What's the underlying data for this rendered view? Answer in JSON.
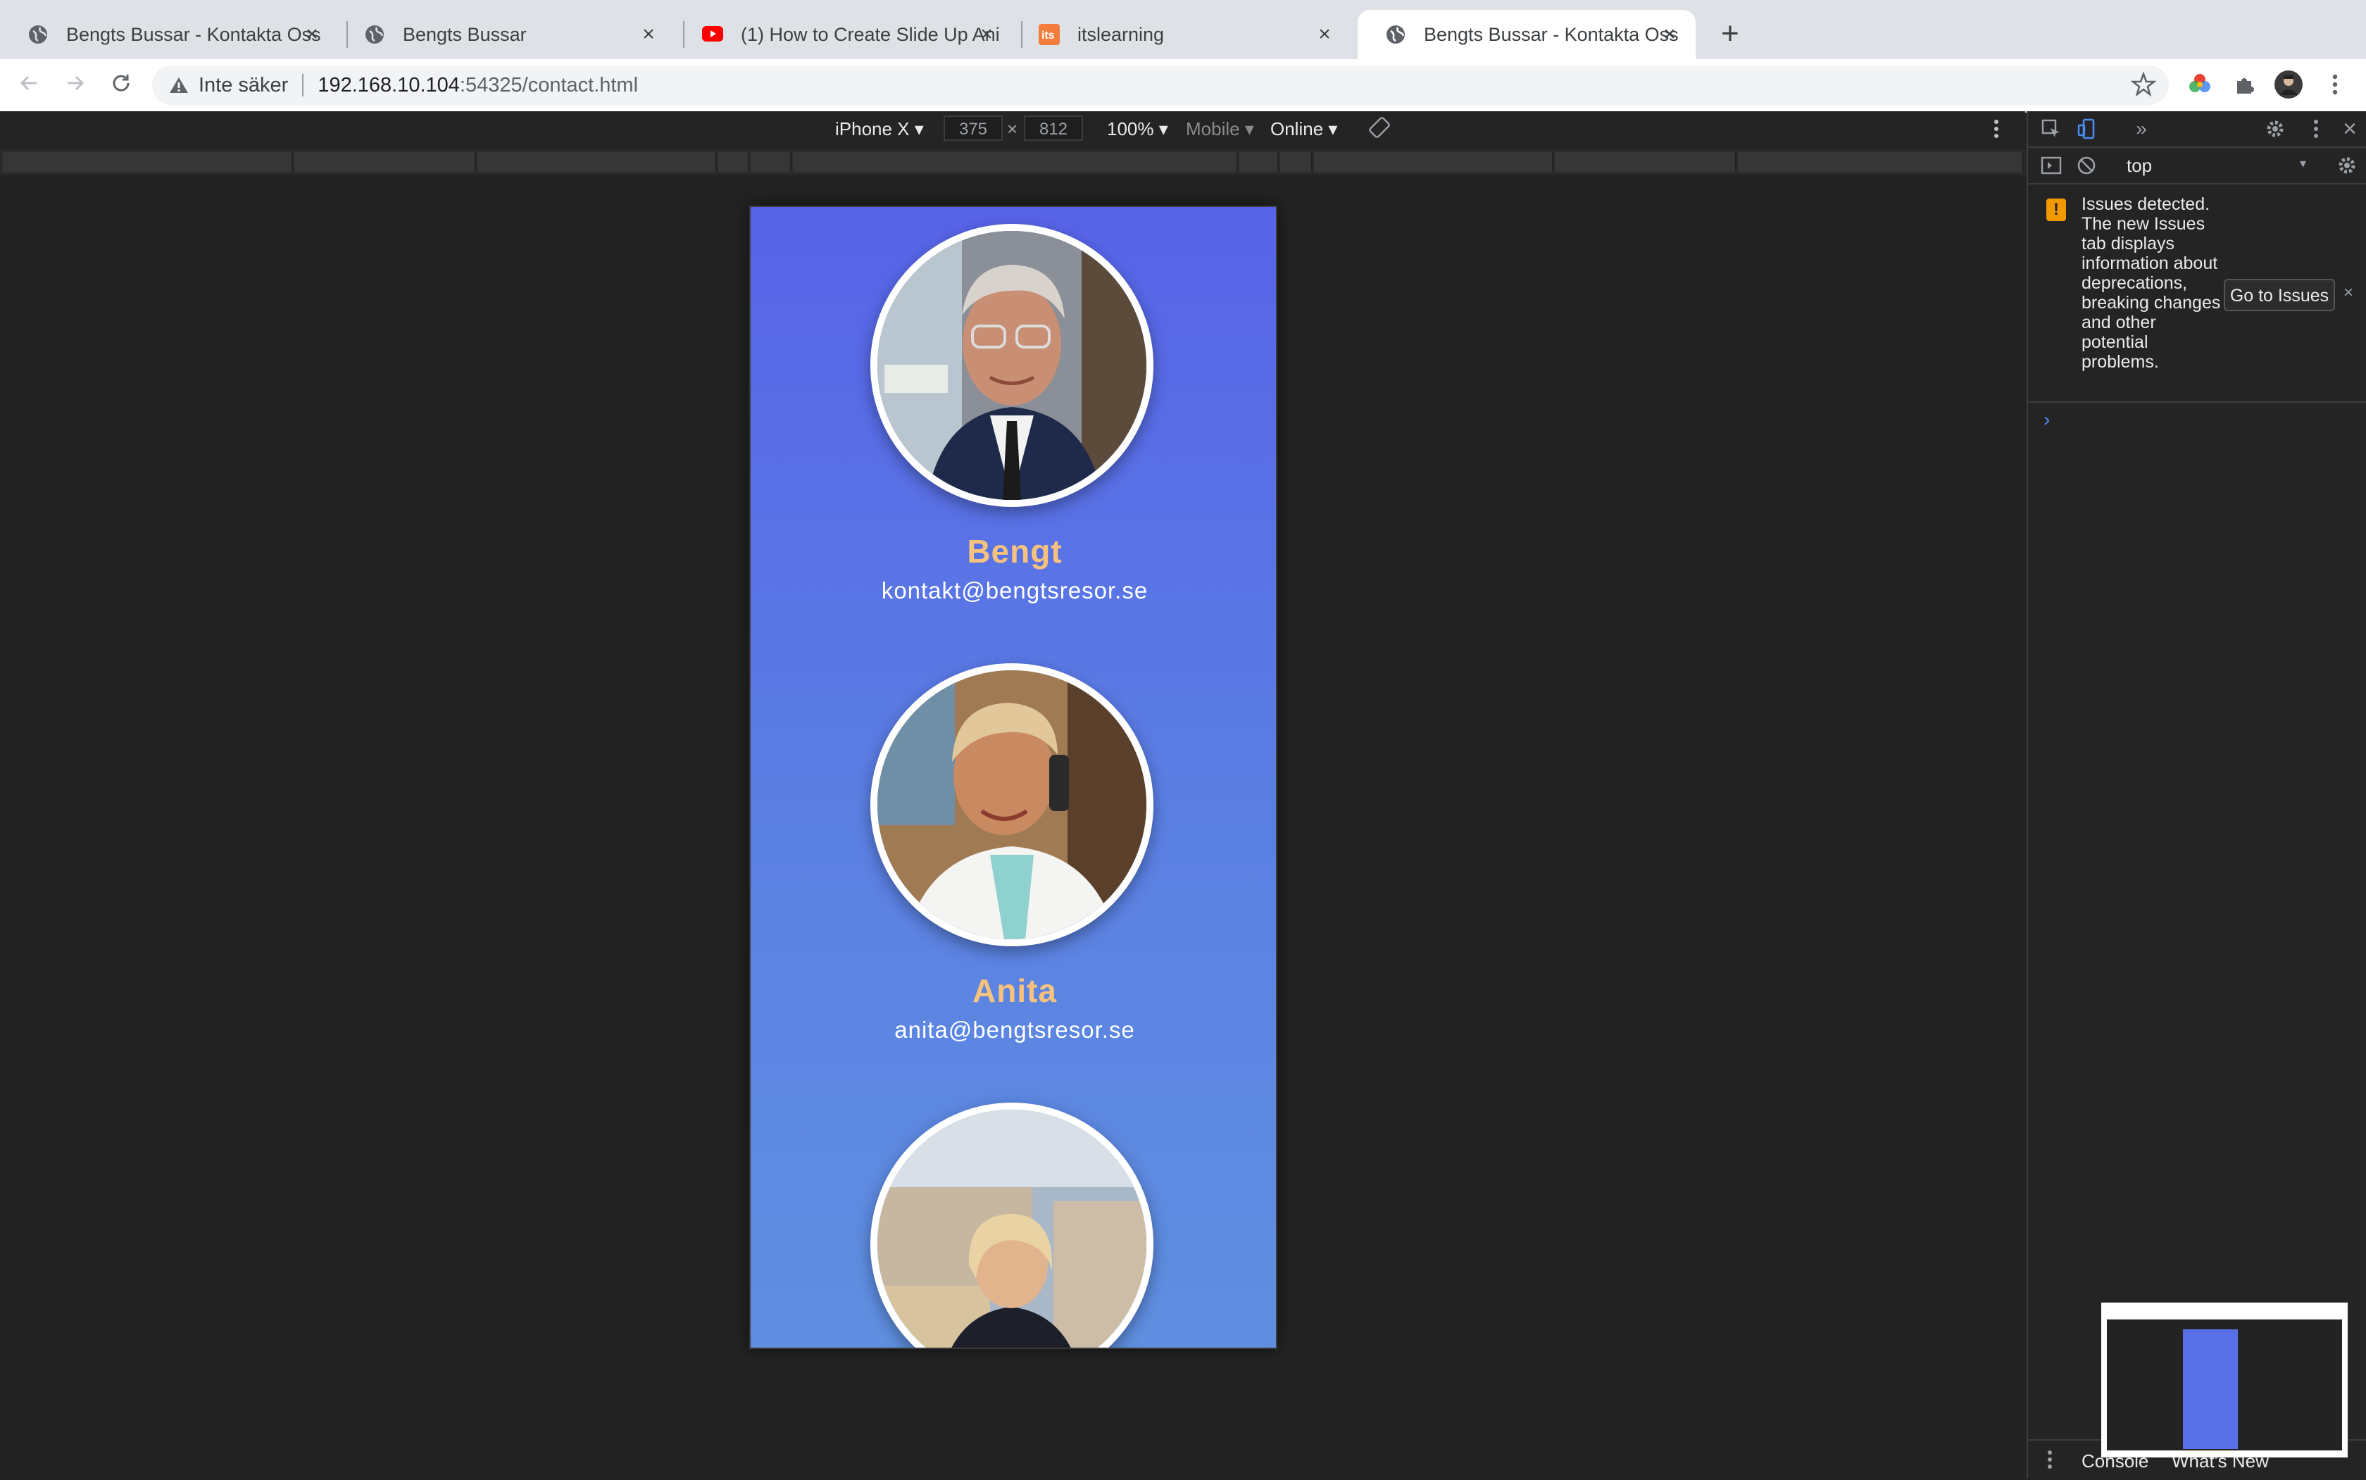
{
  "browser": {
    "tabs": [
      {
        "title": "Bengts Bussar - Kontakta Oss",
        "icon": "globe-icon",
        "active": false
      },
      {
        "title": "Bengts Bussar",
        "icon": "globe-icon",
        "active": false
      },
      {
        "title": "(1) How to Create Slide Up Ani",
        "icon": "youtube-icon",
        "active": false
      },
      {
        "title": "itslearning",
        "icon": "itslearning-icon",
        "active": false
      },
      {
        "title": "Bengts Bussar - Kontakta Oss",
        "icon": "globe-icon",
        "active": true
      }
    ],
    "new_tab": "+",
    "address": {
      "security_label": "Inte säker",
      "host": "192.168.10.104",
      "path": ":54325/contact.html"
    }
  },
  "device_toolbar": {
    "device": "iPhone X",
    "width": "375",
    "height": "812",
    "zoom": "100%",
    "mode": "Mobile",
    "network": "Online"
  },
  "page": {
    "people": [
      {
        "name": "Bengt",
        "email": "kontakt@bengtsresor.se"
      },
      {
        "name": "Anita",
        "email": "anita@bengtsresor.se"
      }
    ],
    "colors": {
      "name": "#f6c27d",
      "email": "#ffffff",
      "bg_top": "#5763e8",
      "bg_bottom": "#5f8fe0"
    }
  },
  "devtools": {
    "context": "top",
    "issues": {
      "message": "Issues detected. The new Issues tab displays information about deprecations, breaking changes and other potential problems.",
      "button": "Go to Issues"
    },
    "prompt": "›",
    "drawer_tabs": [
      "Console",
      "What's New"
    ]
  }
}
